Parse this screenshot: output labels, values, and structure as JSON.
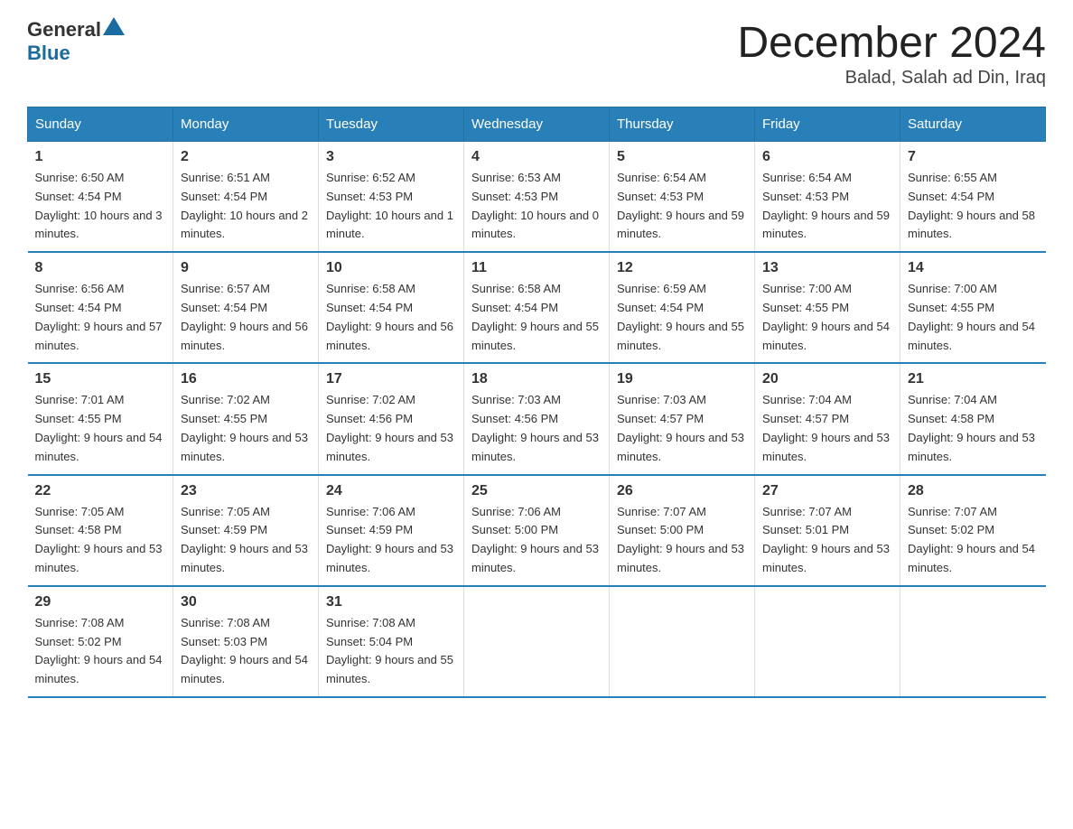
{
  "logo": {
    "general": "General",
    "blue": "Blue"
  },
  "title": "December 2024",
  "location": "Balad, Salah ad Din, Iraq",
  "days_of_week": [
    "Sunday",
    "Monday",
    "Tuesday",
    "Wednesday",
    "Thursday",
    "Friday",
    "Saturday"
  ],
  "weeks": [
    [
      {
        "day": "1",
        "sunrise": "6:50 AM",
        "sunset": "4:54 PM",
        "daylight": "10 hours and 3 minutes."
      },
      {
        "day": "2",
        "sunrise": "6:51 AM",
        "sunset": "4:54 PM",
        "daylight": "10 hours and 2 minutes."
      },
      {
        "day": "3",
        "sunrise": "6:52 AM",
        "sunset": "4:53 PM",
        "daylight": "10 hours and 1 minute."
      },
      {
        "day": "4",
        "sunrise": "6:53 AM",
        "sunset": "4:53 PM",
        "daylight": "10 hours and 0 minutes."
      },
      {
        "day": "5",
        "sunrise": "6:54 AM",
        "sunset": "4:53 PM",
        "daylight": "9 hours and 59 minutes."
      },
      {
        "day": "6",
        "sunrise": "6:54 AM",
        "sunset": "4:53 PM",
        "daylight": "9 hours and 59 minutes."
      },
      {
        "day": "7",
        "sunrise": "6:55 AM",
        "sunset": "4:54 PM",
        "daylight": "9 hours and 58 minutes."
      }
    ],
    [
      {
        "day": "8",
        "sunrise": "6:56 AM",
        "sunset": "4:54 PM",
        "daylight": "9 hours and 57 minutes."
      },
      {
        "day": "9",
        "sunrise": "6:57 AM",
        "sunset": "4:54 PM",
        "daylight": "9 hours and 56 minutes."
      },
      {
        "day": "10",
        "sunrise": "6:58 AM",
        "sunset": "4:54 PM",
        "daylight": "9 hours and 56 minutes."
      },
      {
        "day": "11",
        "sunrise": "6:58 AM",
        "sunset": "4:54 PM",
        "daylight": "9 hours and 55 minutes."
      },
      {
        "day": "12",
        "sunrise": "6:59 AM",
        "sunset": "4:54 PM",
        "daylight": "9 hours and 55 minutes."
      },
      {
        "day": "13",
        "sunrise": "7:00 AM",
        "sunset": "4:55 PM",
        "daylight": "9 hours and 54 minutes."
      },
      {
        "day": "14",
        "sunrise": "7:00 AM",
        "sunset": "4:55 PM",
        "daylight": "9 hours and 54 minutes."
      }
    ],
    [
      {
        "day": "15",
        "sunrise": "7:01 AM",
        "sunset": "4:55 PM",
        "daylight": "9 hours and 54 minutes."
      },
      {
        "day": "16",
        "sunrise": "7:02 AM",
        "sunset": "4:55 PM",
        "daylight": "9 hours and 53 minutes."
      },
      {
        "day": "17",
        "sunrise": "7:02 AM",
        "sunset": "4:56 PM",
        "daylight": "9 hours and 53 minutes."
      },
      {
        "day": "18",
        "sunrise": "7:03 AM",
        "sunset": "4:56 PM",
        "daylight": "9 hours and 53 minutes."
      },
      {
        "day": "19",
        "sunrise": "7:03 AM",
        "sunset": "4:57 PM",
        "daylight": "9 hours and 53 minutes."
      },
      {
        "day": "20",
        "sunrise": "7:04 AM",
        "sunset": "4:57 PM",
        "daylight": "9 hours and 53 minutes."
      },
      {
        "day": "21",
        "sunrise": "7:04 AM",
        "sunset": "4:58 PM",
        "daylight": "9 hours and 53 minutes."
      }
    ],
    [
      {
        "day": "22",
        "sunrise": "7:05 AM",
        "sunset": "4:58 PM",
        "daylight": "9 hours and 53 minutes."
      },
      {
        "day": "23",
        "sunrise": "7:05 AM",
        "sunset": "4:59 PM",
        "daylight": "9 hours and 53 minutes."
      },
      {
        "day": "24",
        "sunrise": "7:06 AM",
        "sunset": "4:59 PM",
        "daylight": "9 hours and 53 minutes."
      },
      {
        "day": "25",
        "sunrise": "7:06 AM",
        "sunset": "5:00 PM",
        "daylight": "9 hours and 53 minutes."
      },
      {
        "day": "26",
        "sunrise": "7:07 AM",
        "sunset": "5:00 PM",
        "daylight": "9 hours and 53 minutes."
      },
      {
        "day": "27",
        "sunrise": "7:07 AM",
        "sunset": "5:01 PM",
        "daylight": "9 hours and 53 minutes."
      },
      {
        "day": "28",
        "sunrise": "7:07 AM",
        "sunset": "5:02 PM",
        "daylight": "9 hours and 54 minutes."
      }
    ],
    [
      {
        "day": "29",
        "sunrise": "7:08 AM",
        "sunset": "5:02 PM",
        "daylight": "9 hours and 54 minutes."
      },
      {
        "day": "30",
        "sunrise": "7:08 AM",
        "sunset": "5:03 PM",
        "daylight": "9 hours and 54 minutes."
      },
      {
        "day": "31",
        "sunrise": "7:08 AM",
        "sunset": "5:04 PM",
        "daylight": "9 hours and 55 minutes."
      },
      null,
      null,
      null,
      null
    ]
  ]
}
